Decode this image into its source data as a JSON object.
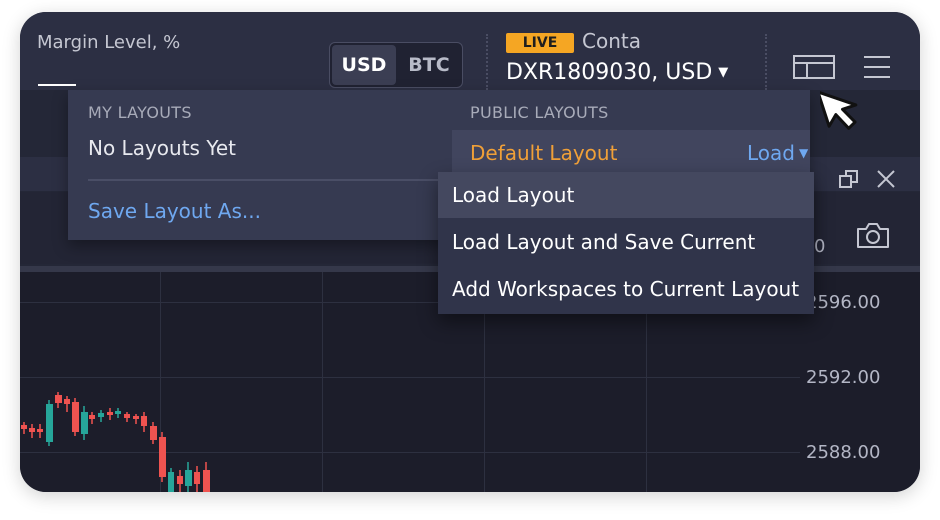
{
  "header": {
    "margin_label": "Margin Level, %",
    "currency_toggle": {
      "usd": "USD",
      "btc": "BTC",
      "selected": "USD"
    },
    "live_badge": "LIVE",
    "account_type": "Conta",
    "account_id": "DXR1809030, USD"
  },
  "layouts_menu": {
    "my_layouts_header": "MY LAYOUTS",
    "empty_text": "No Layouts Yet",
    "save_as": "Save Layout As...",
    "public_layouts_header": "PUBLIC LAYOUTS",
    "default_layout": "Default Layout",
    "load_button": "Load"
  },
  "load_submenu": {
    "items": [
      "Load Layout",
      "Load Layout and Save Current",
      "Add Workspaces to Current Layout"
    ],
    "highlighted_index": 0
  },
  "chart": {
    "price_labels": [
      "2596.00",
      "2592.00",
      "2588.00"
    ],
    "partial_label": "0"
  },
  "colors": {
    "background": "#242737",
    "accent_orange": "#f0a038",
    "link_blue": "#6fa8f0",
    "live_badge": "#f5a623",
    "candle_up": "#26a69a",
    "candle_down": "#ef5350"
  },
  "icons": [
    "layout-icon",
    "hamburger-menu-icon",
    "restore-window-icon",
    "close-icon",
    "camera-icon",
    "cursor-pointer-icon"
  ]
}
